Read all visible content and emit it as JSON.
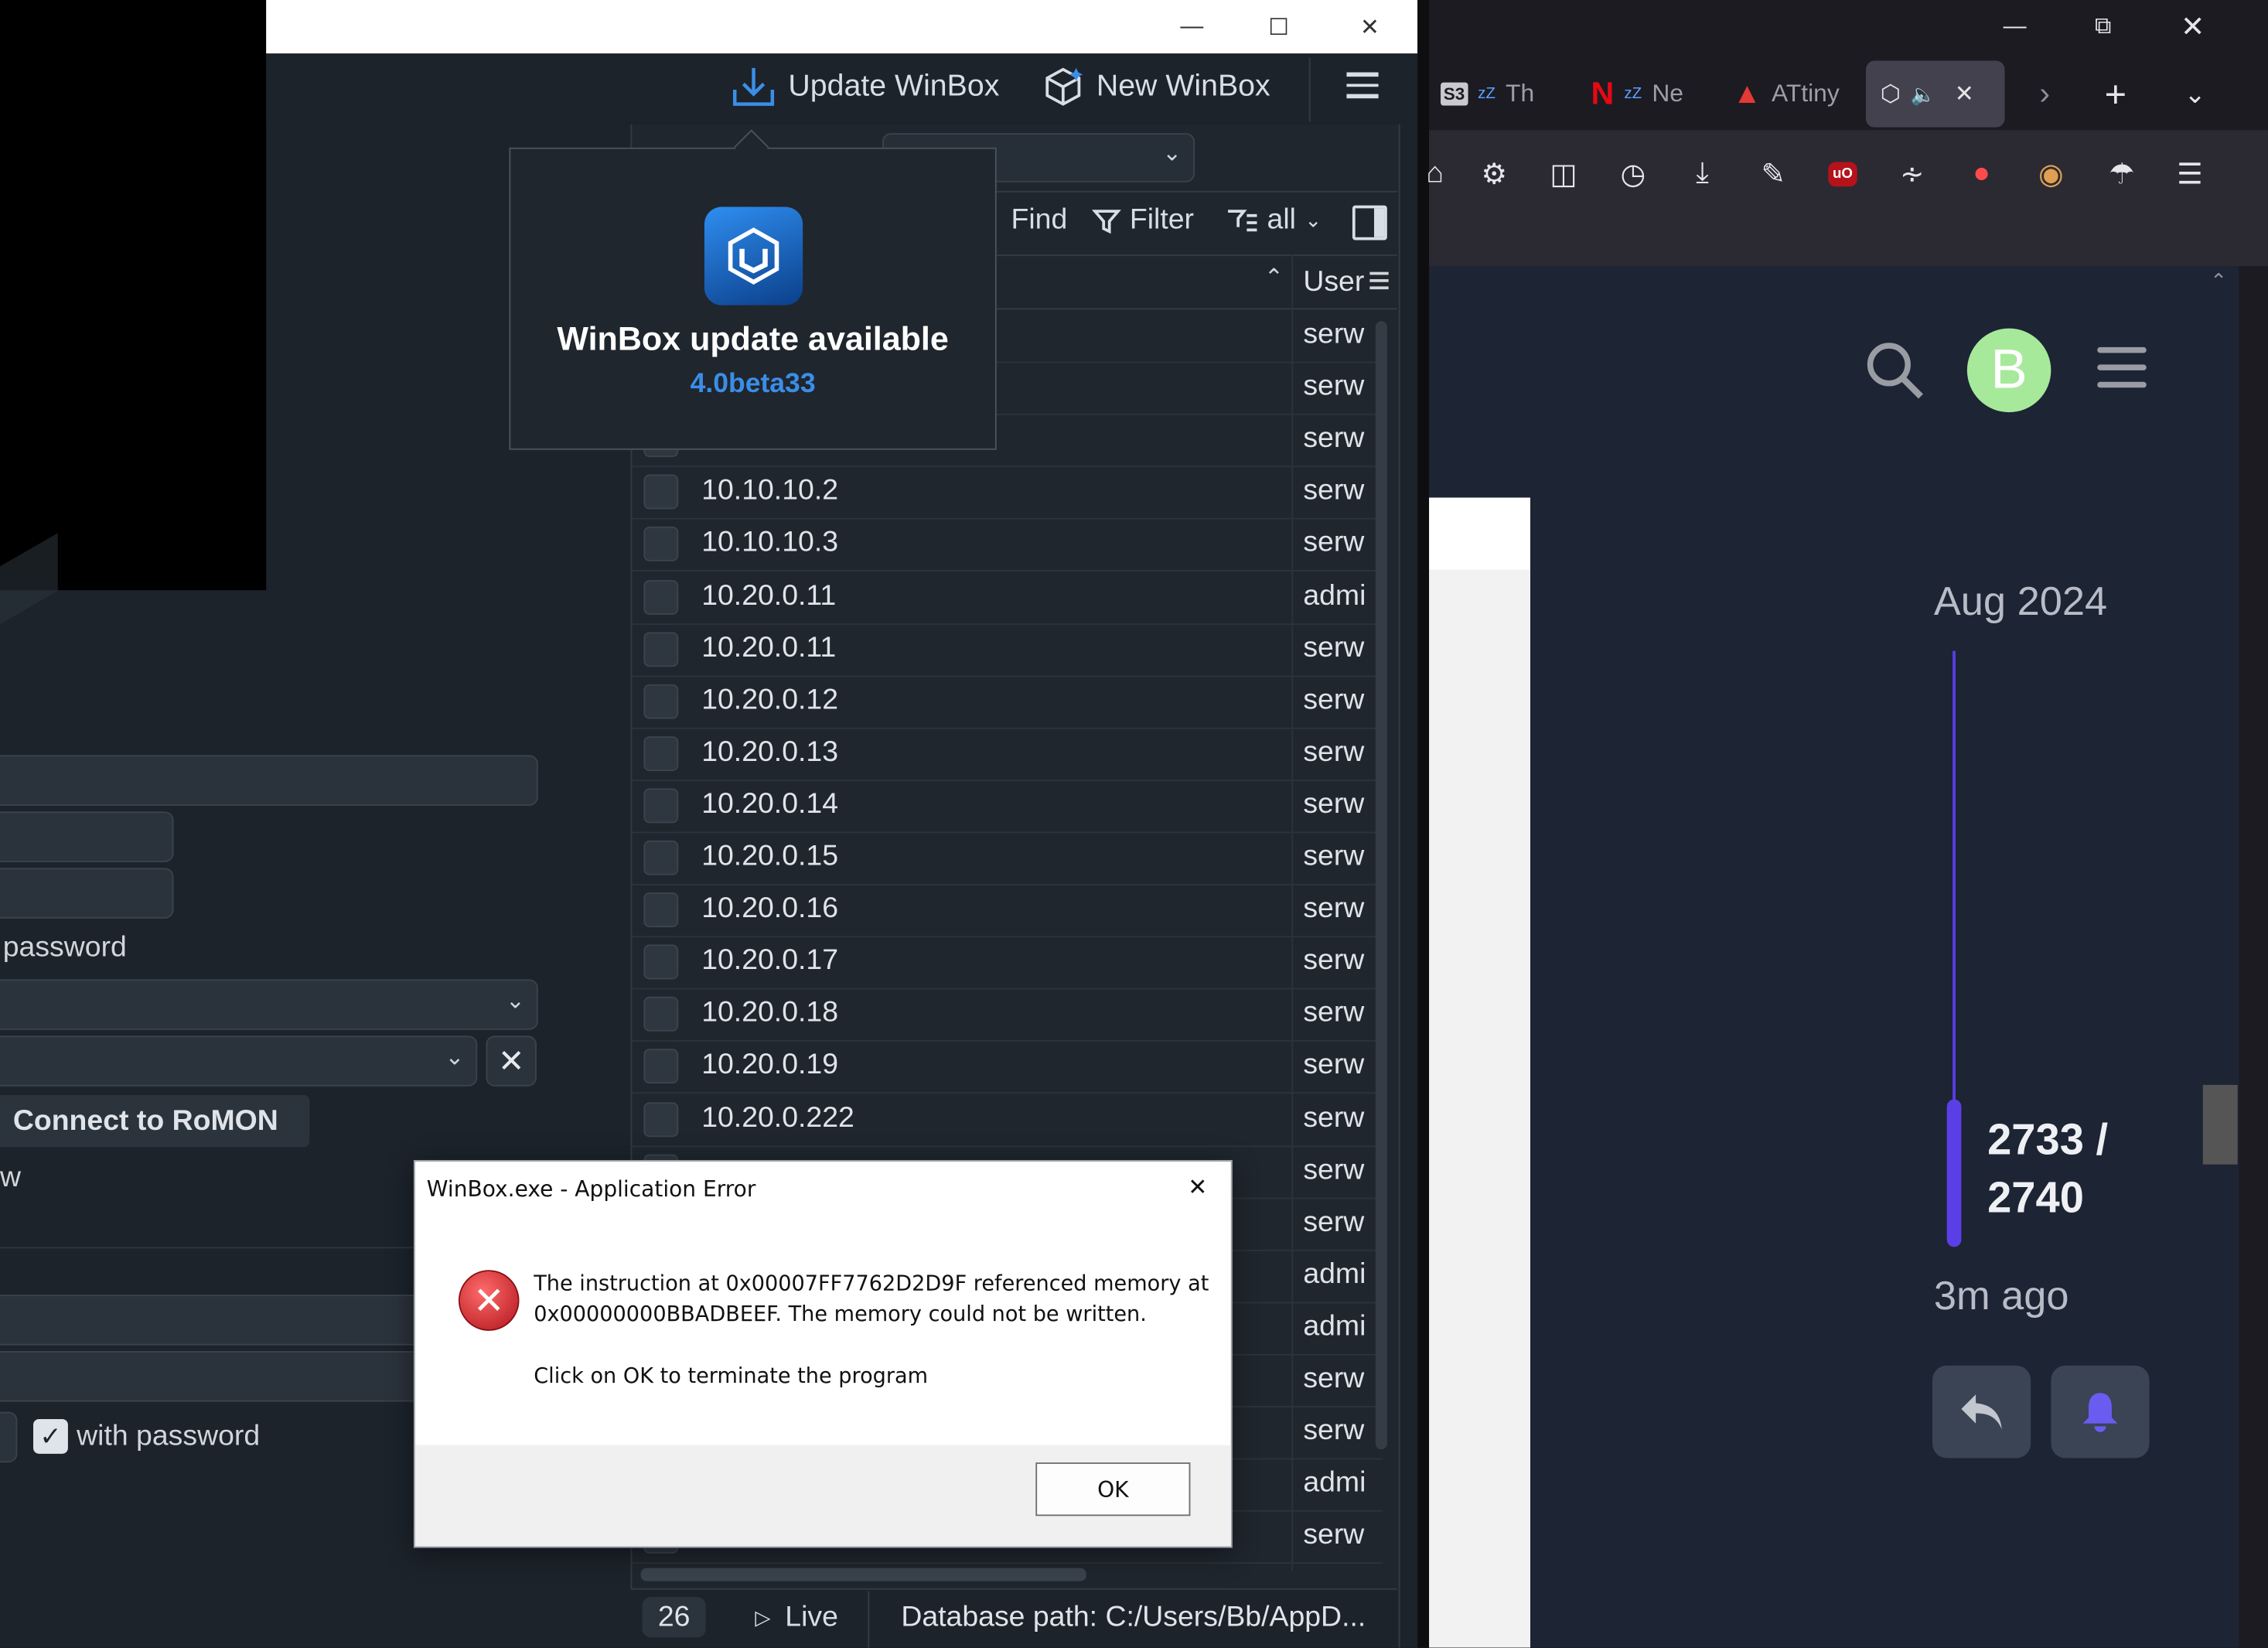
{
  "winbox": {
    "toolbar": {
      "update_label": "Update WinBox",
      "new_label": "New WinBox"
    },
    "table_toolbar": {
      "find_label": "Find",
      "filter_label": "Filter",
      "all_label": "all"
    },
    "table": {
      "user_header": "User",
      "rows": [
        {
          "ip": "",
          "user": "serw"
        },
        {
          "ip": "",
          "user": "serw"
        },
        {
          "ip": "",
          "user": "serw"
        },
        {
          "ip": "10.10.10.2",
          "user": "serw"
        },
        {
          "ip": "10.10.10.3",
          "user": "serw"
        },
        {
          "ip": "10.20.0.11",
          "user": "admi"
        },
        {
          "ip": "10.20.0.11",
          "user": "serw"
        },
        {
          "ip": "10.20.0.12",
          "user": "serw"
        },
        {
          "ip": "10.20.0.13",
          "user": "serw"
        },
        {
          "ip": "10.20.0.14",
          "user": "serw"
        },
        {
          "ip": "10.20.0.15",
          "user": "serw"
        },
        {
          "ip": "10.20.0.16",
          "user": "serw"
        },
        {
          "ip": "10.20.0.17",
          "user": "serw"
        },
        {
          "ip": "10.20.0.18",
          "user": "serw"
        },
        {
          "ip": "10.20.0.19",
          "user": "serw"
        },
        {
          "ip": "10.20.0.222",
          "user": "serw"
        },
        {
          "ip": "",
          "user": "serw"
        },
        {
          "ip": "",
          "user": "serw"
        },
        {
          "ip": "",
          "user": "admi"
        },
        {
          "ip": "",
          "user": "admi"
        },
        {
          "ip": "",
          "user": "serw"
        },
        {
          "ip": "",
          "user": "serw"
        },
        {
          "ip": "",
          "user": "admi"
        },
        {
          "ip": "",
          "user": "serw"
        }
      ]
    },
    "status": {
      "count": "26",
      "live_label": "Live",
      "db_path": "Database path: C:/Users/Bb/AppD..."
    },
    "left_form": {
      "password_label": "password",
      "connect_romon_label": "Connect to RoMON",
      "w_fragment": "w",
      "with_password_label": "with password"
    },
    "popover": {
      "title": "WinBox update available",
      "version": "4.0beta33"
    }
  },
  "error_dialog": {
    "title": "WinBox.exe - Application Error",
    "line1": "The instruction at 0x00007FF7762D2D9F referenced memory at",
    "line2": "0x00000000BBADBEEF. The memory could not be written.",
    "line3": "Click on OK to terminate the program",
    "ok_label": "OK"
  },
  "browser": {
    "tabs": [
      {
        "label": "Th",
        "icon": "s3-icon"
      },
      {
        "label": "Ne",
        "icon": "netflix-icon"
      },
      {
        "label": "ATtiny",
        "icon": "microchip-icon"
      }
    ],
    "avatar_letter": "B",
    "timeline": {
      "date": "Aug 2024",
      "progress_line1": "2733 /",
      "progress_line2": "2740",
      "ago": "3m ago"
    }
  },
  "colors": {
    "accent_blue": "#3b8ee8",
    "avatar_green": "#a7e99a",
    "timeline_purple": "#5b3fe6",
    "error_red": "#c8202a"
  }
}
